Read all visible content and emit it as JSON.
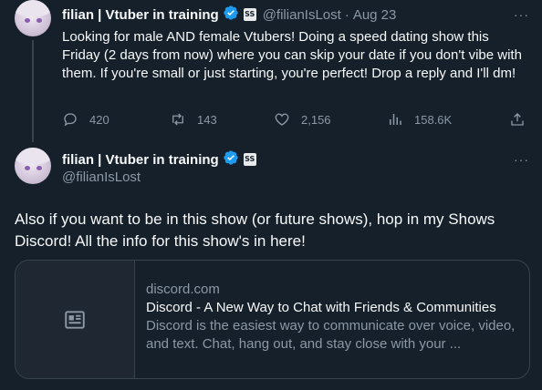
{
  "tweet1": {
    "display_name": "filian | Vtuber in training",
    "handle": "@filianIsLost",
    "separator": "·",
    "date": "Aug 23",
    "badge_label": "SS",
    "text": "Looking for male AND female Vtubers! Doing a speed dating show this Friday (2 days from now) where you can skip your date if you don't vibe with them. If you're small or just starting, you're perfect! Drop a reply and I'll dm!",
    "more": "···",
    "actions": {
      "replies": "420",
      "retweets": "143",
      "likes": "2,156",
      "views": "158.6K"
    }
  },
  "tweet2": {
    "display_name": "filian | Vtuber in training",
    "handle": "@filianIsLost",
    "badge_label": "SS",
    "more": "···",
    "text": "Also if you want to be in this show (or future shows), hop in my Shows Discord! All the info for this show's in here!",
    "card": {
      "domain": "discord.com",
      "title": "Discord - A New Way to Chat with Friends & Communities",
      "description": "Discord is the easiest way to communicate over voice, video, and text. Chat, hang out, and stay close with your ..."
    }
  },
  "colors": {
    "background": "#15202b",
    "text": "#f7f9f9",
    "muted": "#8b98a5",
    "verified": "#1d9bf0",
    "border": "#38444d"
  },
  "icons": [
    "reply-icon",
    "retweet-icon",
    "like-icon",
    "views-icon",
    "share-icon",
    "verified-icon",
    "article-icon"
  ]
}
